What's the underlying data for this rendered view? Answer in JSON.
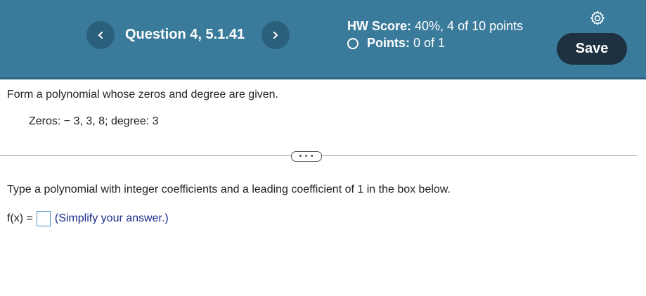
{
  "header": {
    "question_title": "Question 4, 5.1.41",
    "prev_icon": "chevron-left-icon",
    "next_icon": "chevron-right-icon",
    "hw_score_label": "HW Score:",
    "hw_score_value": "40%, 4 of 10 points",
    "points_label": "Points:",
    "points_value": "0 of 1",
    "settings_icon": "gear-icon",
    "save_label": "Save",
    "colors": {
      "bar": "#3a7a9a",
      "save": "#1d3140"
    }
  },
  "problem": {
    "prompt": "Form a polynomial whose zeros and degree are given.",
    "given": "Zeros:  − 3, 3, 8;   degree: 3",
    "expand_label": "• • •"
  },
  "answer": {
    "instruction": "Type a polynomial with integer coefficients and a leading coefficient of 1 in the box below.",
    "lhs": "f(x) =",
    "hint": "(Simplify your answer.)"
  }
}
